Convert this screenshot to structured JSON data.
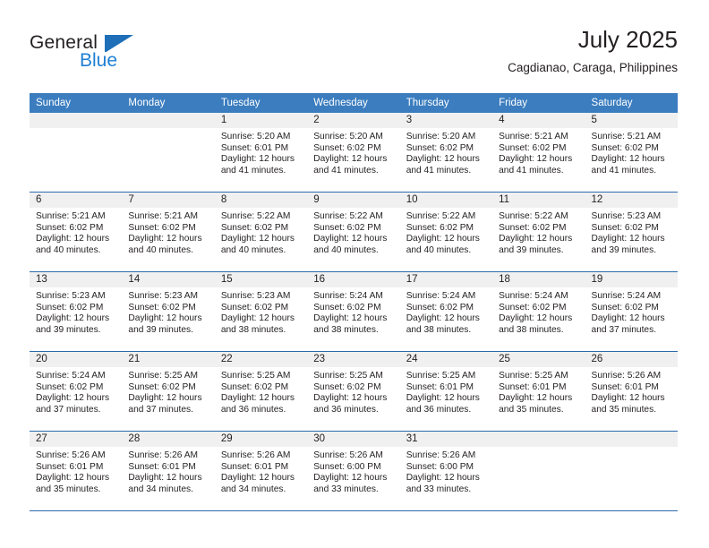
{
  "brand": {
    "name_part1": "General",
    "name_part2": "Blue",
    "triangle_icon": "triangle-icon",
    "accent_color": "#1e7fd4"
  },
  "header": {
    "title": "July 2025",
    "subtitle": "Cagdianao, Caraga, Philippines"
  },
  "calendar": {
    "header_bg": "#3b7dbf",
    "daynum_bg": "#f0f0f0",
    "divider_color": "#2b6cad",
    "weekdays": [
      "Sunday",
      "Monday",
      "Tuesday",
      "Wednesday",
      "Thursday",
      "Friday",
      "Saturday"
    ],
    "weeks": [
      [
        {
          "day": "",
          "sunrise": "",
          "sunset": "",
          "daylight_line1": "",
          "daylight_line2": ""
        },
        {
          "day": "",
          "sunrise": "",
          "sunset": "",
          "daylight_line1": "",
          "daylight_line2": ""
        },
        {
          "day": "1",
          "sunrise": "Sunrise: 5:20 AM",
          "sunset": "Sunset: 6:01 PM",
          "daylight_line1": "Daylight: 12 hours",
          "daylight_line2": "and 41 minutes."
        },
        {
          "day": "2",
          "sunrise": "Sunrise: 5:20 AM",
          "sunset": "Sunset: 6:02 PM",
          "daylight_line1": "Daylight: 12 hours",
          "daylight_line2": "and 41 minutes."
        },
        {
          "day": "3",
          "sunrise": "Sunrise: 5:20 AM",
          "sunset": "Sunset: 6:02 PM",
          "daylight_line1": "Daylight: 12 hours",
          "daylight_line2": "and 41 minutes."
        },
        {
          "day": "4",
          "sunrise": "Sunrise: 5:21 AM",
          "sunset": "Sunset: 6:02 PM",
          "daylight_line1": "Daylight: 12 hours",
          "daylight_line2": "and 41 minutes."
        },
        {
          "day": "5",
          "sunrise": "Sunrise: 5:21 AM",
          "sunset": "Sunset: 6:02 PM",
          "daylight_line1": "Daylight: 12 hours",
          "daylight_line2": "and 41 minutes."
        }
      ],
      [
        {
          "day": "6",
          "sunrise": "Sunrise: 5:21 AM",
          "sunset": "Sunset: 6:02 PM",
          "daylight_line1": "Daylight: 12 hours",
          "daylight_line2": "and 40 minutes."
        },
        {
          "day": "7",
          "sunrise": "Sunrise: 5:21 AM",
          "sunset": "Sunset: 6:02 PM",
          "daylight_line1": "Daylight: 12 hours",
          "daylight_line2": "and 40 minutes."
        },
        {
          "day": "8",
          "sunrise": "Sunrise: 5:22 AM",
          "sunset": "Sunset: 6:02 PM",
          "daylight_line1": "Daylight: 12 hours",
          "daylight_line2": "and 40 minutes."
        },
        {
          "day": "9",
          "sunrise": "Sunrise: 5:22 AM",
          "sunset": "Sunset: 6:02 PM",
          "daylight_line1": "Daylight: 12 hours",
          "daylight_line2": "and 40 minutes."
        },
        {
          "day": "10",
          "sunrise": "Sunrise: 5:22 AM",
          "sunset": "Sunset: 6:02 PM",
          "daylight_line1": "Daylight: 12 hours",
          "daylight_line2": "and 40 minutes."
        },
        {
          "day": "11",
          "sunrise": "Sunrise: 5:22 AM",
          "sunset": "Sunset: 6:02 PM",
          "daylight_line1": "Daylight: 12 hours",
          "daylight_line2": "and 39 minutes."
        },
        {
          "day": "12",
          "sunrise": "Sunrise: 5:23 AM",
          "sunset": "Sunset: 6:02 PM",
          "daylight_line1": "Daylight: 12 hours",
          "daylight_line2": "and 39 minutes."
        }
      ],
      [
        {
          "day": "13",
          "sunrise": "Sunrise: 5:23 AM",
          "sunset": "Sunset: 6:02 PM",
          "daylight_line1": "Daylight: 12 hours",
          "daylight_line2": "and 39 minutes."
        },
        {
          "day": "14",
          "sunrise": "Sunrise: 5:23 AM",
          "sunset": "Sunset: 6:02 PM",
          "daylight_line1": "Daylight: 12 hours",
          "daylight_line2": "and 39 minutes."
        },
        {
          "day": "15",
          "sunrise": "Sunrise: 5:23 AM",
          "sunset": "Sunset: 6:02 PM",
          "daylight_line1": "Daylight: 12 hours",
          "daylight_line2": "and 38 minutes."
        },
        {
          "day": "16",
          "sunrise": "Sunrise: 5:24 AM",
          "sunset": "Sunset: 6:02 PM",
          "daylight_line1": "Daylight: 12 hours",
          "daylight_line2": "and 38 minutes."
        },
        {
          "day": "17",
          "sunrise": "Sunrise: 5:24 AM",
          "sunset": "Sunset: 6:02 PM",
          "daylight_line1": "Daylight: 12 hours",
          "daylight_line2": "and 38 minutes."
        },
        {
          "day": "18",
          "sunrise": "Sunrise: 5:24 AM",
          "sunset": "Sunset: 6:02 PM",
          "daylight_line1": "Daylight: 12 hours",
          "daylight_line2": "and 38 minutes."
        },
        {
          "day": "19",
          "sunrise": "Sunrise: 5:24 AM",
          "sunset": "Sunset: 6:02 PM",
          "daylight_line1": "Daylight: 12 hours",
          "daylight_line2": "and 37 minutes."
        }
      ],
      [
        {
          "day": "20",
          "sunrise": "Sunrise: 5:24 AM",
          "sunset": "Sunset: 6:02 PM",
          "daylight_line1": "Daylight: 12 hours",
          "daylight_line2": "and 37 minutes."
        },
        {
          "day": "21",
          "sunrise": "Sunrise: 5:25 AM",
          "sunset": "Sunset: 6:02 PM",
          "daylight_line1": "Daylight: 12 hours",
          "daylight_line2": "and 37 minutes."
        },
        {
          "day": "22",
          "sunrise": "Sunrise: 5:25 AM",
          "sunset": "Sunset: 6:02 PM",
          "daylight_line1": "Daylight: 12 hours",
          "daylight_line2": "and 36 minutes."
        },
        {
          "day": "23",
          "sunrise": "Sunrise: 5:25 AM",
          "sunset": "Sunset: 6:02 PM",
          "daylight_line1": "Daylight: 12 hours",
          "daylight_line2": "and 36 minutes."
        },
        {
          "day": "24",
          "sunrise": "Sunrise: 5:25 AM",
          "sunset": "Sunset: 6:01 PM",
          "daylight_line1": "Daylight: 12 hours",
          "daylight_line2": "and 36 minutes."
        },
        {
          "day": "25",
          "sunrise": "Sunrise: 5:25 AM",
          "sunset": "Sunset: 6:01 PM",
          "daylight_line1": "Daylight: 12 hours",
          "daylight_line2": "and 35 minutes."
        },
        {
          "day": "26",
          "sunrise": "Sunrise: 5:26 AM",
          "sunset": "Sunset: 6:01 PM",
          "daylight_line1": "Daylight: 12 hours",
          "daylight_line2": "and 35 minutes."
        }
      ],
      [
        {
          "day": "27",
          "sunrise": "Sunrise: 5:26 AM",
          "sunset": "Sunset: 6:01 PM",
          "daylight_line1": "Daylight: 12 hours",
          "daylight_line2": "and 35 minutes."
        },
        {
          "day": "28",
          "sunrise": "Sunrise: 5:26 AM",
          "sunset": "Sunset: 6:01 PM",
          "daylight_line1": "Daylight: 12 hours",
          "daylight_line2": "and 34 minutes."
        },
        {
          "day": "29",
          "sunrise": "Sunrise: 5:26 AM",
          "sunset": "Sunset: 6:01 PM",
          "daylight_line1": "Daylight: 12 hours",
          "daylight_line2": "and 34 minutes."
        },
        {
          "day": "30",
          "sunrise": "Sunrise: 5:26 AM",
          "sunset": "Sunset: 6:00 PM",
          "daylight_line1": "Daylight: 12 hours",
          "daylight_line2": "and 33 minutes."
        },
        {
          "day": "31",
          "sunrise": "Sunrise: 5:26 AM",
          "sunset": "Sunset: 6:00 PM",
          "daylight_line1": "Daylight: 12 hours",
          "daylight_line2": "and 33 minutes."
        },
        {
          "day": "",
          "sunrise": "",
          "sunset": "",
          "daylight_line1": "",
          "daylight_line2": ""
        },
        {
          "day": "",
          "sunrise": "",
          "sunset": "",
          "daylight_line1": "",
          "daylight_line2": ""
        }
      ]
    ]
  }
}
